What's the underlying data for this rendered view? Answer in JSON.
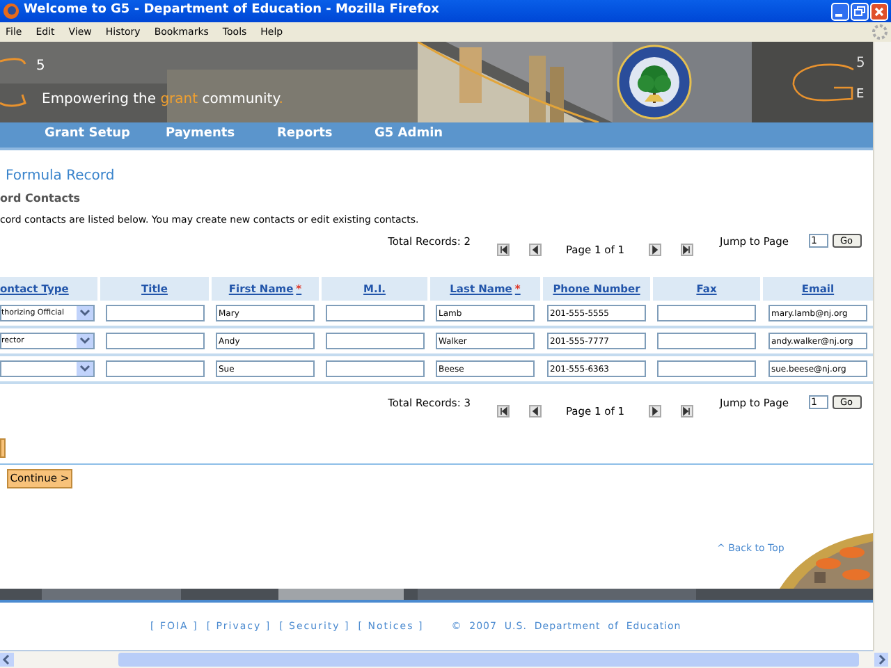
{
  "window": {
    "title": "Welcome to G5 - Department of Education - Mozilla Firefox"
  },
  "menu": [
    "File",
    "Edit",
    "View",
    "History",
    "Bookmarks",
    "Tools",
    "Help"
  ],
  "banner": {
    "logo_sup": "5",
    "tagline": [
      {
        "text": "Empowering the ",
        "highlight": false
      },
      {
        "text": "grant",
        "highlight": true
      },
      {
        "text": " community",
        "highlight": false
      },
      {
        "text": ".",
        "highlight": true
      }
    ],
    "right_logo": [
      "5",
      "E"
    ]
  },
  "nav": [
    "Grant Setup",
    "Payments",
    "Reports",
    "G5 Admin"
  ],
  "page_title": "Formula Record",
  "section_title": "ord Contacts",
  "description": "cord contacts are listed below. You may create new contacts or edit existing contacts.",
  "pager_top": {
    "total": "Total Records: 2",
    "page": "Page 1 of 1",
    "jump_label": "Jump to Page",
    "jump_value": "1",
    "go": "Go"
  },
  "table": {
    "columns": [
      {
        "label": "ontact Type"
      },
      {
        "label": "Title"
      },
      {
        "label": "First Name",
        "required_mark": "*"
      },
      {
        "label": "M.I."
      },
      {
        "label": "Last Name",
        "required_mark": "*"
      },
      {
        "label": "Phone Number"
      },
      {
        "label": "Fax"
      },
      {
        "label": "Email"
      }
    ],
    "rows": [
      {
        "contact_type": "thorizing Official",
        "title": "",
        "first_name": "Mary",
        "mi": "",
        "last_name": "Lamb",
        "phone": "201-555-5555",
        "fax": "",
        "email": "mary.lamb@nj.org"
      },
      {
        "contact_type": "rector",
        "title": "",
        "first_name": "Andy",
        "mi": "",
        "last_name": "Walker",
        "phone": "201-555-7777",
        "fax": "",
        "email": "andy.walker@nj.org"
      },
      {
        "contact_type": "",
        "title": "",
        "first_name": "Sue",
        "mi": "",
        "last_name": "Beese",
        "phone": "201-555-6363",
        "fax": "",
        "email": "sue.beese@nj.org"
      }
    ]
  },
  "pager_bottom": {
    "total": "Total Records: 3",
    "page": "Page 1 of 1",
    "jump_label": "Jump to Page",
    "jump_value": "1",
    "go": "Go"
  },
  "continue_button": "Continue >",
  "back_to_top": "^ Back to Top",
  "footer": {
    "links": [
      "[ FOIA ]",
      "[ Privacy ]",
      "[ Security ]",
      "[ Notices ]"
    ],
    "copyright": "©  2007  U.S.  Department  of  Education"
  }
}
